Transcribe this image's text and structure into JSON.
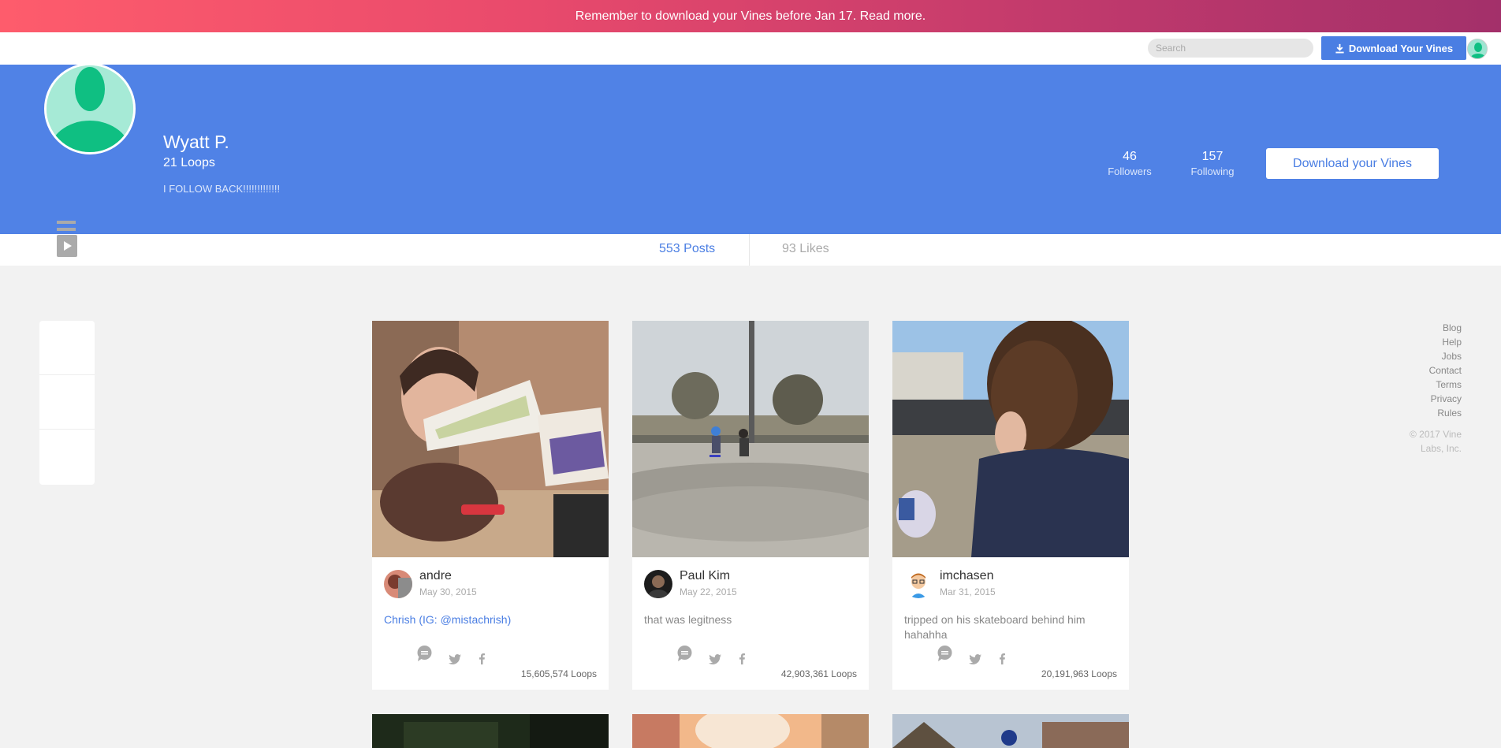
{
  "banner": {
    "text": "Remember to download your Vines before Jan 17. Read more."
  },
  "topbar": {
    "search_placeholder": "Search",
    "download_label": "Download Your Vines"
  },
  "profile": {
    "name": "Wyatt P.",
    "loops": "21 Loops",
    "bio": "I FOLLOW BACK!!!!!!!!!!!!!",
    "followers_count": "46",
    "followers_label": "Followers",
    "following_count": "157",
    "following_label": "Following",
    "download_label": "Download your Vines"
  },
  "tabs": {
    "posts": "553 Posts",
    "likes": "93 Likes"
  },
  "posts": [
    {
      "user": "andre",
      "date": "May 30, 2015",
      "caption": "Chrish (IG: @mistachrish)",
      "loops": "15,605,574 Loops"
    },
    {
      "user": "Paul Kim",
      "date": "May 22, 2015",
      "caption": "that was legitness",
      "loops": "42,903,361 Loops"
    },
    {
      "user": "imchasen",
      "date": "Mar 31, 2015",
      "caption": "tripped on his skateboard behind him hahahha",
      "loops": "20,191,963 Loops"
    }
  ],
  "footer": {
    "links": [
      "Blog",
      "Help",
      "Jobs",
      "Contact",
      "Terms",
      "Privacy",
      "Rules"
    ],
    "copyright": "© 2017 Vine Labs, Inc."
  },
  "colors": {
    "accent": "#4a7ee3",
    "hero": "#5082e6",
    "banner_start": "#fe5c6c",
    "banner_end": "#a3306a"
  }
}
